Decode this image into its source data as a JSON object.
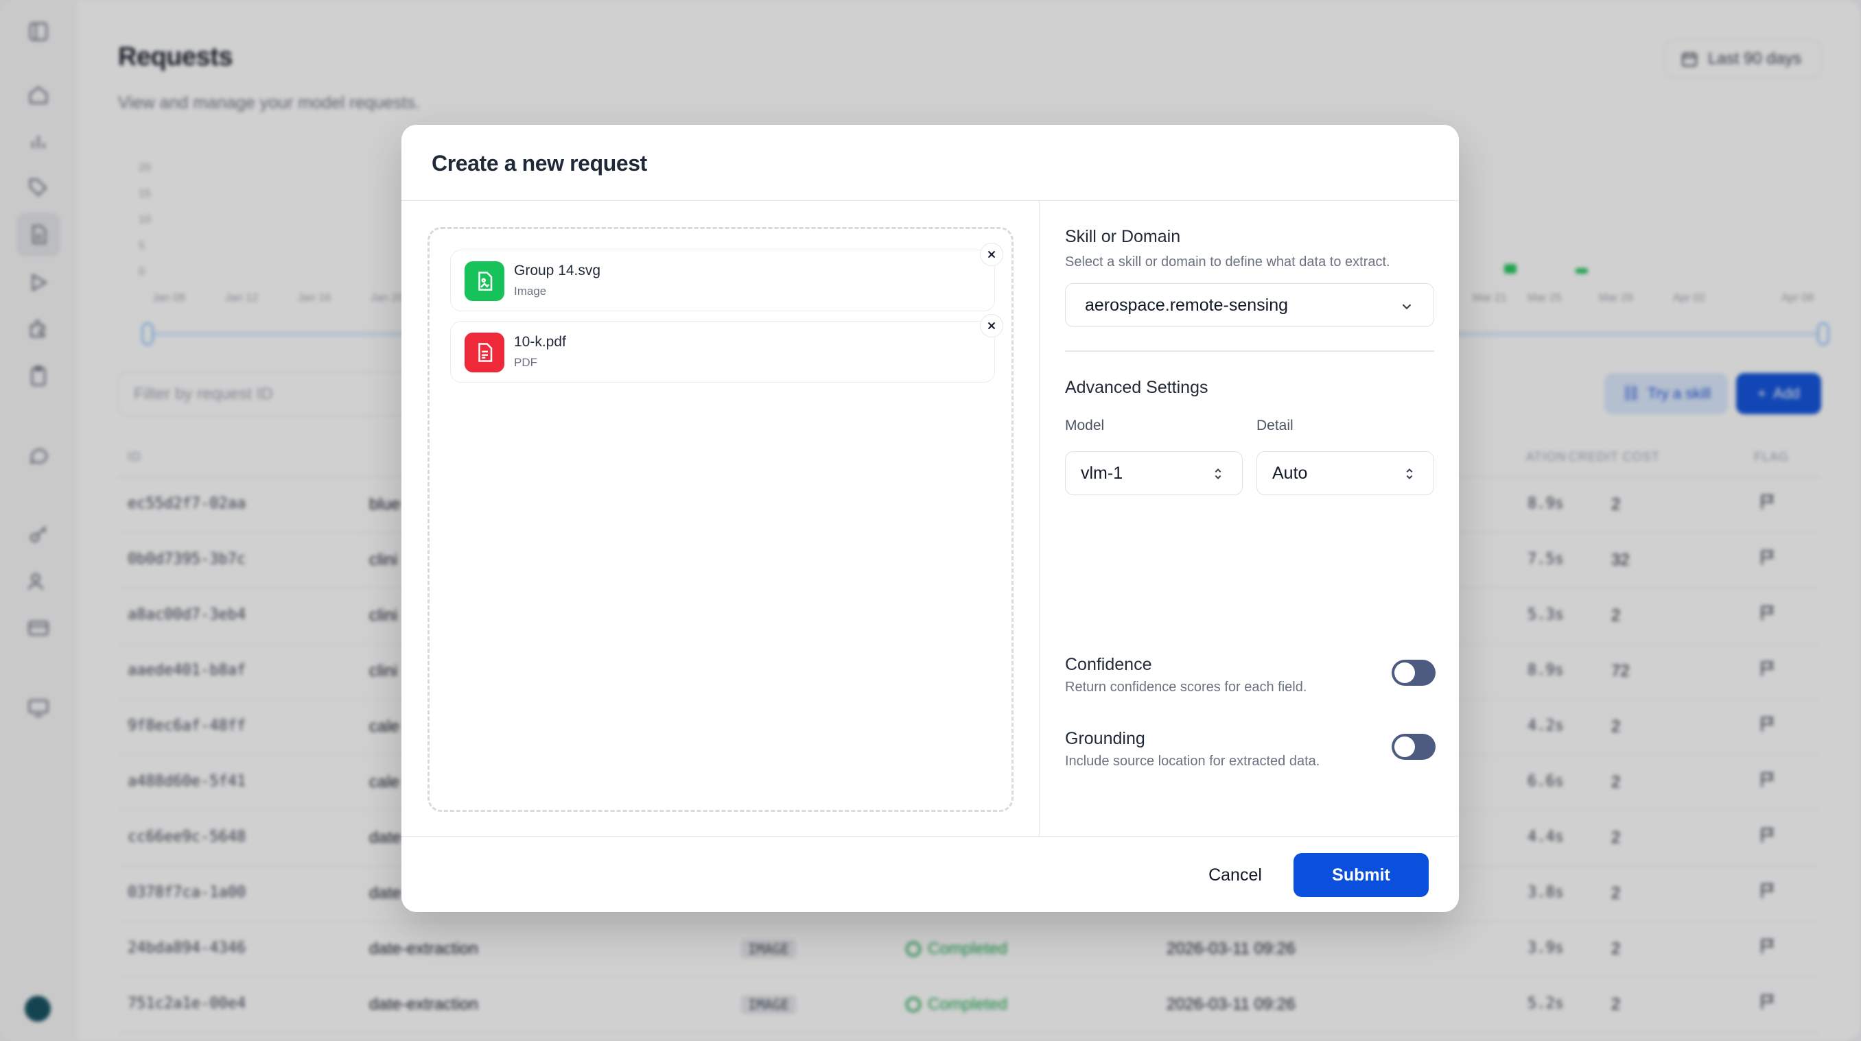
{
  "background": {
    "page_title": "Requests",
    "page_subtitle": "View and manage your model requests.",
    "date_range": "Last 90 days",
    "chart_y_ticks": [
      "20",
      "15",
      "10",
      "5",
      "0"
    ],
    "chart_x_ticks": [
      "Jan 08",
      "Jan 12",
      "Jan 16",
      "Jan 20",
      "Mar 21",
      "Mar 25",
      "Mar 29",
      "Apr 02",
      "Apr 08"
    ],
    "filter_placeholder": "Filter by request ID",
    "try_skill_label": "Try a skill",
    "add_label": "Add",
    "columns": [
      "ID",
      "ATION",
      "CREDIT COST",
      "FLAG"
    ],
    "rows": [
      {
        "id": "ec55d2f7-02aa",
        "skill": "blue",
        "type": "",
        "status": "",
        "date": "",
        "duration": "8.9s",
        "cost": "2"
      },
      {
        "id": "0b0d7395-3b7c",
        "skill": "clini",
        "type": "",
        "status": "",
        "date": "",
        "duration": "7.5s",
        "cost": "32"
      },
      {
        "id": "a8ac00d7-3eb4",
        "skill": "clini",
        "type": "",
        "status": "",
        "date": "",
        "duration": "5.3s",
        "cost": "2"
      },
      {
        "id": "aaede401-b8af",
        "skill": "clini",
        "type": "",
        "status": "",
        "date": "",
        "duration": "8.9s",
        "cost": "72"
      },
      {
        "id": "9f8ec6af-48ff",
        "skill": "cale",
        "type": "",
        "status": "",
        "date": "",
        "duration": "4.2s",
        "cost": "2"
      },
      {
        "id": "a488d60e-5f41",
        "skill": "cale",
        "type": "",
        "status": "",
        "date": "",
        "duration": "6.6s",
        "cost": "2"
      },
      {
        "id": "cc66ee9c-5648",
        "skill": "date",
        "type": "",
        "status": "",
        "date": "",
        "duration": "4.4s",
        "cost": "2"
      },
      {
        "id": "0378f7ca-1a00",
        "skill": "date",
        "type": "",
        "status": "",
        "date": "",
        "duration": "3.8s",
        "cost": "2"
      },
      {
        "id": "24bda894-4346",
        "skill": "date-extraction",
        "type": "IMAGE",
        "status": "Completed",
        "date": "2026-03-11 09:26",
        "duration": "3.9s",
        "cost": "2"
      },
      {
        "id": "751c2a1e-00e4",
        "skill": "date-extraction",
        "type": "IMAGE",
        "status": "Completed",
        "date": "2026-03-11 09:26",
        "duration": "5.2s",
        "cost": "2"
      }
    ]
  },
  "modal": {
    "title": "Create a new request",
    "files": [
      {
        "name": "Group 14.svg",
        "type": "Image",
        "color": "#17c25a"
      },
      {
        "name": "10-k.pdf",
        "type": "PDF",
        "color": "#ee2a3a"
      }
    ],
    "skill": {
      "label": "Skill or Domain",
      "description": "Select a skill or domain to define what data to extract.",
      "value": "aerospace.remote-sensing"
    },
    "advanced": {
      "label": "Advanced Settings",
      "model_label": "Model",
      "model_value": "vlm-1",
      "detail_label": "Detail",
      "detail_value": "Auto"
    },
    "confidence": {
      "label": "Confidence",
      "description": "Return confidence scores for each field.",
      "enabled": false
    },
    "grounding": {
      "label": "Grounding",
      "description": "Include source location for extracted data.",
      "enabled": false
    },
    "cancel_label": "Cancel",
    "submit_label": "Submit"
  },
  "colors": {
    "primary": "#0b50dc",
    "toggle_off": "#4e5b80",
    "success": "#16a34a"
  }
}
